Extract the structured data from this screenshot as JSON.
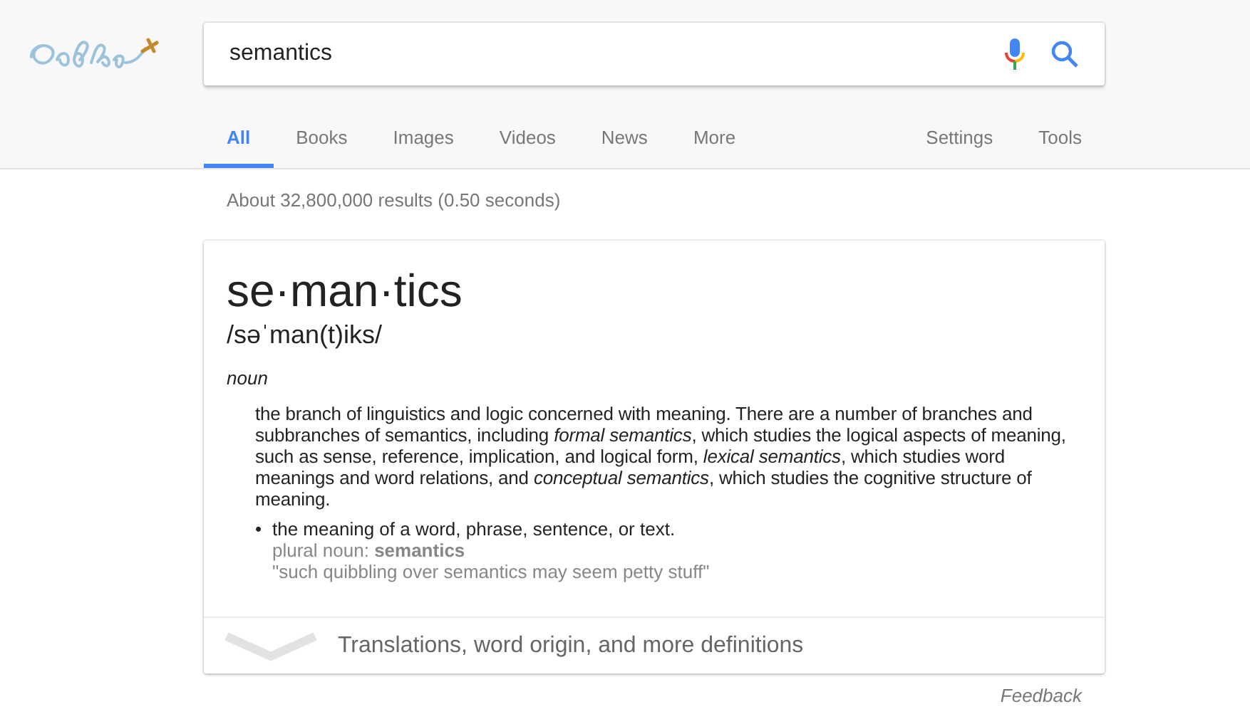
{
  "search": {
    "value": "semantics"
  },
  "tabs": [
    {
      "label": "All",
      "selected": true
    },
    {
      "label": "Books",
      "selected": false
    },
    {
      "label": "Images",
      "selected": false
    },
    {
      "label": "Videos",
      "selected": false
    },
    {
      "label": "News",
      "selected": false
    },
    {
      "label": "More",
      "selected": false
    }
  ],
  "tools": [
    "Settings",
    "Tools"
  ],
  "result_stats": "About 32,800,000 results (0.50 seconds)",
  "definition": {
    "word": "se·man·tics",
    "pronunciation": "/səˈman(t)iks/",
    "part_of_speech": "noun",
    "meanings": [
      {
        "kind": "paragraph",
        "text": "the branch of linguistics and logic concerned with meaning. There are a number of branches and subbranches of semantics, including *formal semantics*, which studies the logical aspects of meaning, such as sense, reference, implication, and logical form, *lexical semantics*, which studies word meanings and word relations, and *conceptual semantics*, which studies the cognitive structure of meaning."
      },
      {
        "kind": "bullet",
        "bullet": "•",
        "text": "the meaning of a word, phrase, sentence, or text.",
        "note": "plural noun: **semantics**",
        "example": "\"such quibbling over semantics may seem petty stuff\""
      }
    ],
    "more": "Translations, word origin, and more definitions"
  },
  "feedback": "Feedback"
}
